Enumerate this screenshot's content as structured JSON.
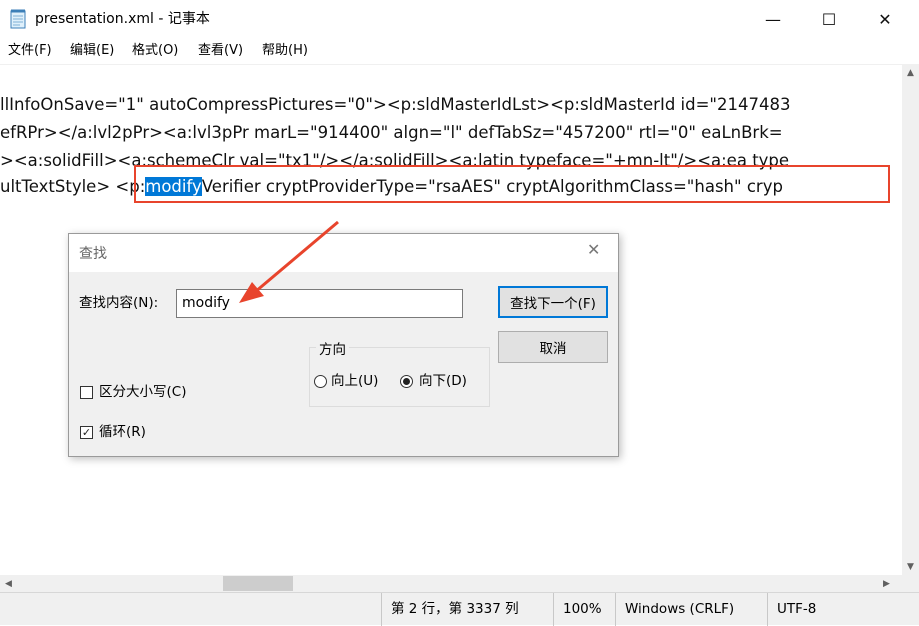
{
  "window": {
    "title": "presentation.xml - 记事本",
    "minimize_glyph": "—",
    "maximize_glyph": "☐",
    "close_glyph": "✕"
  },
  "menu": [
    {
      "label": "文件(F)"
    },
    {
      "label": "编辑(E)"
    },
    {
      "label": "格式(O)"
    },
    {
      "label": "查看(V)"
    },
    {
      "label": "帮助(H)"
    }
  ],
  "editor": {
    "lines": [
      "llInfoOnSave=\"1\" autoCompressPictures=\"0\"><p:sldMasterIdLst><p:sldMasterId id=\"2147483",
      "efRPr></a:lvl2pPr><a:lvl3pPr marL=\"914400\" algn=\"l\" defTabSz=\"457200\" rtl=\"0\" eaLnBrk=",
      "><a:solidFill><a:schemeClr val=\"tx1\"/></a:solidFill><a:latin typeface=\"+mn-lt\"/><a:ea type"
    ],
    "line4_before": "ultTextStyle>",
    "line4_prefix": "<p:",
    "line4_match": "modify",
    "line4_after": "Verifier cryptProviderType=\"rsaAES\" cryptAlgorithmClass=\"hash\" cryp"
  },
  "find_dialog": {
    "title": "查找",
    "close_glyph": "✕",
    "find_label": "查找内容(N):",
    "find_value": "modify",
    "find_next_button": "查找下一个(F)",
    "cancel_button": "取消",
    "direction_title": "方向",
    "up_label": "向上(U)",
    "down_label": "向下(D)",
    "selected_direction": "down",
    "match_case_label": "区分大小写(C)",
    "match_case_checked": false,
    "wrap_label": "循环(R)",
    "wrap_checked": true
  },
  "status": {
    "position": "第 2 行，第 3337 列",
    "zoom": "100%",
    "line_ending": "Windows (CRLF)",
    "encoding": "UTF-8"
  },
  "colors": {
    "selection": "#0078d7",
    "annotation": "#e8442c"
  },
  "icons": {
    "app": "notepad-icon",
    "arrow": "annotation-arrow"
  }
}
